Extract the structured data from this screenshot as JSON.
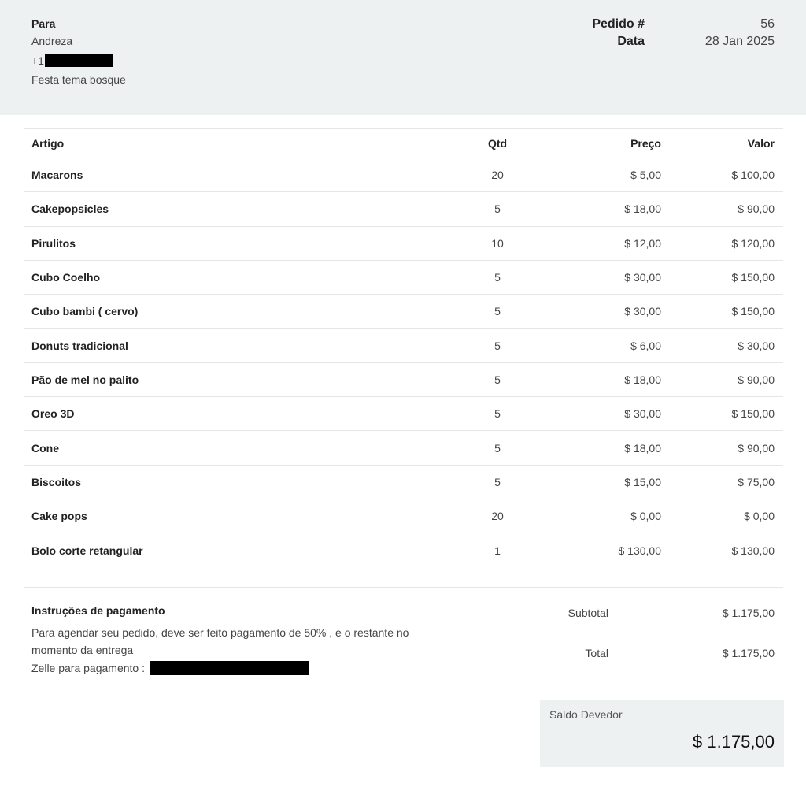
{
  "header": {
    "to_label": "Para",
    "customer_name": "Andreza",
    "phone_prefix": "+1",
    "note": "Festa tema bosque",
    "order_label": "Pedido #",
    "order_number": "56",
    "date_label": "Data",
    "date_value": "28 Jan 2025"
  },
  "table": {
    "headers": {
      "item": "Artigo",
      "qty": "Qtd",
      "price": "Preço",
      "value": "Valor"
    },
    "rows": [
      {
        "item": "Macarons",
        "qty": "20",
        "price": "$ 5,00",
        "value": "$ 100,00"
      },
      {
        "item": "Cakepopsicles",
        "qty": "5",
        "price": "$ 18,00",
        "value": "$ 90,00"
      },
      {
        "item": "Pirulitos",
        "qty": "10",
        "price": "$ 12,00",
        "value": "$ 120,00"
      },
      {
        "item": "Cubo Coelho",
        "qty": "5",
        "price": "$ 30,00",
        "value": "$ 150,00"
      },
      {
        "item": "Cubo bambi ( cervo)",
        "qty": "5",
        "price": "$ 30,00",
        "value": "$ 150,00"
      },
      {
        "item": "Donuts tradicional",
        "qty": "5",
        "price": "$ 6,00",
        "value": "$ 30,00"
      },
      {
        "item": "Pão de mel no palito",
        "qty": "5",
        "price": "$ 18,00",
        "value": "$ 90,00"
      },
      {
        "item": "Oreo 3D",
        "qty": "5",
        "price": "$ 30,00",
        "value": "$ 150,00"
      },
      {
        "item": "Cone",
        "qty": "5",
        "price": "$ 18,00",
        "value": "$ 90,00"
      },
      {
        "item": "Biscoitos",
        "qty": "5",
        "price": "$ 15,00",
        "value": "$ 75,00"
      },
      {
        "item": "Cake pops",
        "qty": "20",
        "price": "$ 0,00",
        "value": "$ 0,00"
      },
      {
        "item": "Bolo corte retangular",
        "qty": "1",
        "price": "$ 130,00",
        "value": "$ 130,00"
      }
    ]
  },
  "payment": {
    "title": "Instruções de pagamento",
    "text": "Para agendar seu pedido, deve ser feito pagamento de 50% , e o restante no momento da entrega",
    "zelle_label": "Zelle para pagamento :"
  },
  "summary": {
    "subtotal_label": "Subtotal",
    "subtotal_value": "$ 1.175,00",
    "total_label": "Total",
    "total_value": "$ 1.175,00",
    "balance_label": "Saldo Devedor",
    "balance_value": "$ 1.175,00"
  },
  "colors": {
    "header_bg": "#eef1f2",
    "redaction": "#000000"
  }
}
